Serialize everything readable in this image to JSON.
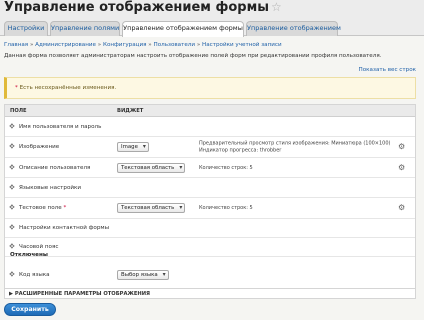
{
  "page": {
    "title": "Управление отображением формы",
    "star_glyph": "☆"
  },
  "tabs": [
    {
      "label": "Настройки",
      "active": false
    },
    {
      "label": "Управление полями",
      "active": false
    },
    {
      "label": "Управление отображением формы",
      "active": true
    },
    {
      "label": "Управление отображением",
      "active": false
    }
  ],
  "breadcrumb": [
    "Главная",
    "Администрирование",
    "Конфигурация",
    "Пользователи",
    "Настройки учетной записи"
  ],
  "breadcrumb_separator": "»",
  "description": "Данная форма позволяет администраторам настроить отображение полей форм при редактировании профиля пользователя.",
  "show_weights_link": "Показать вес строк",
  "warning": {
    "asterisk": "*",
    "text": "Есть несохранённые изменения."
  },
  "table": {
    "col_field": "ПОЛЕ",
    "col_widget": "ВИДЖЕТ",
    "rows": [
      {
        "label": "Имя пользователя и пароль",
        "widget": "",
        "summary": [],
        "gear": false,
        "changed": false
      },
      {
        "label": "Изображение",
        "widget": "Image",
        "summary": [
          "Предварительный просмотр стиля изображения: Миниатюра (100×100)",
          "Индикатор прогресса: throbber"
        ],
        "gear": true,
        "changed": false
      },
      {
        "label": "Описание пользователя",
        "widget": "Текстовая область",
        "summary": [
          "Количество строк: 5"
        ],
        "gear": true,
        "changed": false
      },
      {
        "label": "Языковые настройки",
        "widget": "",
        "summary": [],
        "gear": false,
        "changed": false
      },
      {
        "label": "Тестовое поле",
        "widget": "Текстовая область",
        "summary": [
          "Количество строк: 5"
        ],
        "gear": true,
        "changed": true
      },
      {
        "label": "Настройки контактной формы",
        "widget": "",
        "summary": [],
        "gear": false,
        "changed": false
      },
      {
        "label": "Часовой пояс",
        "widget": "",
        "summary": [],
        "gear": false,
        "changed": false
      }
    ],
    "disabled_region": "Отключены",
    "disabled_rows": [
      {
        "label": "Код языка",
        "widget": "Выбор языка"
      }
    ]
  },
  "details": {
    "marker": "▶",
    "label": "РАСШИРЕННЫЕ ПАРАМЕТРЫ ОТОБРАЖЕНИЯ"
  },
  "save_button": "Сохранить",
  "icons": {
    "drag": "drag-handle-icon",
    "gear": "gear-icon",
    "star": "star-icon"
  },
  "colors": {
    "link": "#1f60a8",
    "primary_button": "#2a79c6",
    "warning_bg": "#fdf8e3",
    "warning_border": "#e0b93a",
    "asterisk": "#cc0033"
  }
}
